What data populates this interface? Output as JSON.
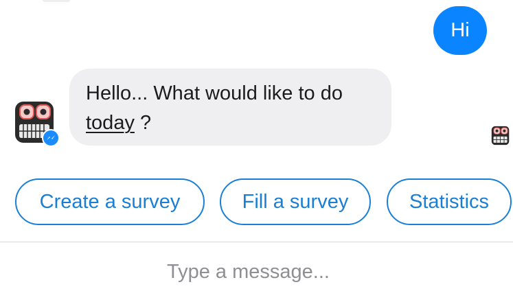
{
  "conversation": {
    "user_message": "Hi",
    "bot_message": {
      "text_before_link": "Hello... What would like to do",
      "link_text": "today",
      "text_after_link": " ?"
    }
  },
  "avatar": {
    "icon": "robot-icon",
    "badge_icon": "messenger-icon"
  },
  "quick_replies": [
    {
      "label": "Create a survey"
    },
    {
      "label": "Fill a survey"
    },
    {
      "label": "Statistics"
    }
  ],
  "composer": {
    "placeholder": "Type a message..."
  },
  "colors": {
    "user_bubble": "#0a84ff",
    "bot_bubble": "#efeff1",
    "quick_reply_accent": "#1a7fd4",
    "placeholder_text": "#8e8e93"
  }
}
